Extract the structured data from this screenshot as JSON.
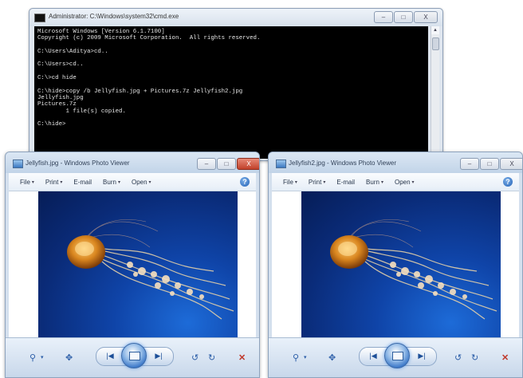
{
  "cmd": {
    "title": "Administrator: C:\\Windows\\system32\\cmd.exe",
    "buttons": {
      "minimize": "–",
      "maximize": "□",
      "close": "X"
    },
    "lines": [
      "Microsoft Windows [Version 6.1.7100]",
      "Copyright (c) 2009 Microsoft Corporation.  All rights reserved.",
      "",
      "C:\\Users\\Aditya>cd..",
      "",
      "C:\\Users>cd..",
      "",
      "C:\\>cd hide",
      "",
      "C:\\hide>copy /b Jellyfish.jpg + Pictures.7z Jellyfish2.jpg",
      "Jellyfish.jpg",
      "Pictures.7z",
      "        1 file(s) copied.",
      "",
      "C:\\hide>"
    ]
  },
  "viewer_left": {
    "title": "Jellyfish.jpg - Windows Photo Viewer",
    "buttons": {
      "minimize": "–",
      "maximize": "□",
      "close": "X"
    },
    "menu": [
      "File",
      "Print",
      "E-mail",
      "Burn",
      "Open"
    ],
    "help": "?",
    "image_name": "jellyfish-photo"
  },
  "viewer_right": {
    "title": "Jellyfish2.jpg - Windows Photo Viewer",
    "buttons": {
      "minimize": "–",
      "maximize": "□",
      "close": "X"
    },
    "menu": [
      "File",
      "Print",
      "E-mail",
      "Burn",
      "Open"
    ],
    "help": "?",
    "image_name": "jellyfish-photo"
  },
  "toolbar": {
    "zoom": "⚲",
    "zoom_caret": "▾",
    "fit": "✥",
    "prev": "|◀",
    "next": "▶|",
    "rotate_ccw": "↺",
    "rotate_cw": "↻",
    "delete": "✕"
  },
  "colors": {
    "close_red": "#c0412a",
    "image_blue": "#0f44a8",
    "jelly_orange": "#d9861f"
  }
}
